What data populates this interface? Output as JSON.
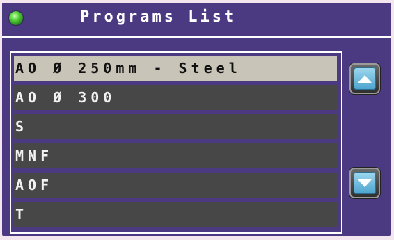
{
  "header": {
    "title": "Programs List",
    "status_led_color": "#58d23c"
  },
  "list": {
    "selected_index": 0,
    "items": [
      {
        "label": "AO Ø 250mm - Steel"
      },
      {
        "label": "AO Ø 300"
      },
      {
        "label": "S"
      },
      {
        "label": "MNF"
      },
      {
        "label": "AOF"
      },
      {
        "label": "T"
      }
    ]
  },
  "controls": {
    "scroll_up_icon": "triangle-up",
    "scroll_down_icon": "triangle-down"
  },
  "colors": {
    "background": "#4b3a82",
    "row": "#474747",
    "row_selected": "#c9c4b8",
    "button_face": "#7ec6e6"
  }
}
